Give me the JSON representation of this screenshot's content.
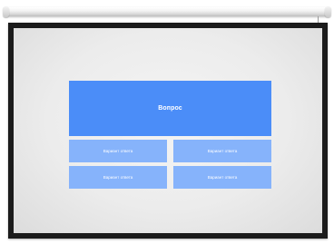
{
  "quiz": {
    "question": "Вопрос",
    "answers": [
      {
        "label": "Вариант ответа"
      },
      {
        "label": "Вариант ответа"
      },
      {
        "label": "Вариант ответа"
      },
      {
        "label": "Вариант ответа"
      }
    ]
  },
  "colors": {
    "question_bg": "#4b8df8",
    "answer_bg": "#86b3fb",
    "frame": "#1b1b1b",
    "surface": "#ececec"
  }
}
